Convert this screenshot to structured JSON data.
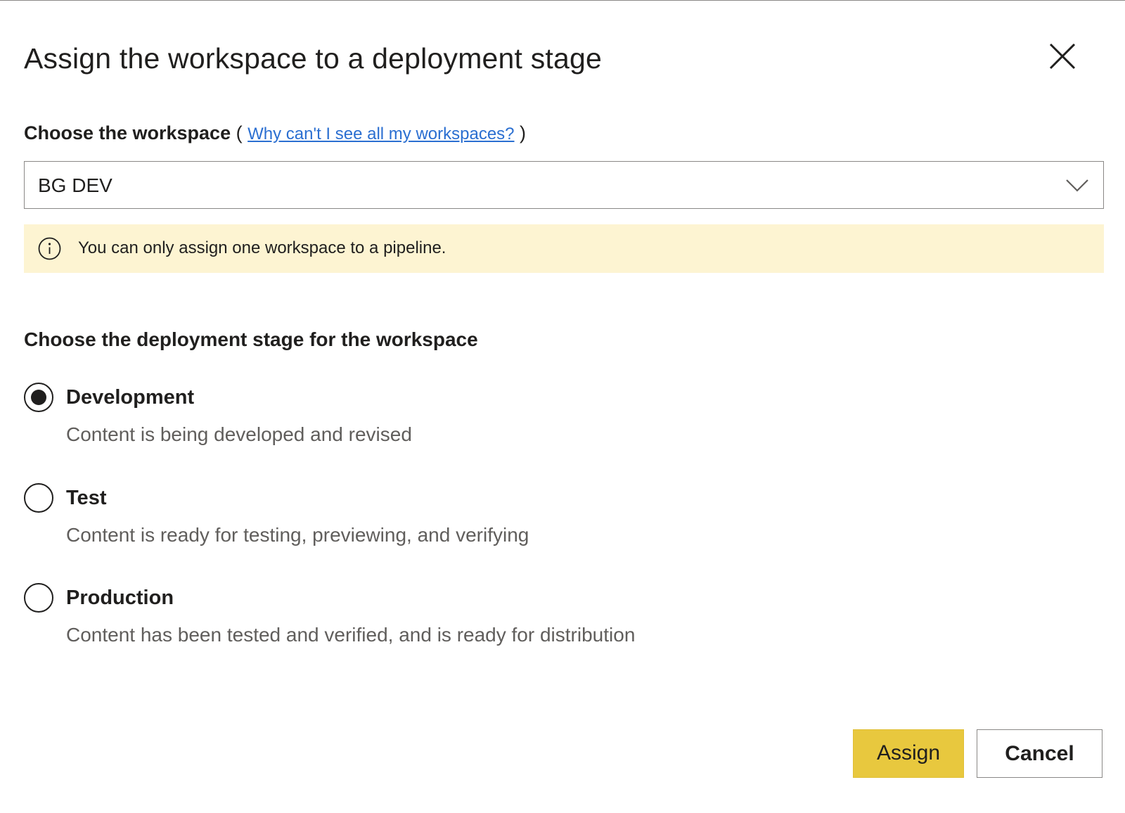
{
  "dialog": {
    "title": "Assign the workspace to a deployment stage",
    "close_icon": "close-icon"
  },
  "workspace": {
    "label": "Choose the workspace",
    "paren_open": "(",
    "help_link": "Why can't I see all my workspaces?",
    "paren_close": ")",
    "selected": "BG DEV",
    "dropdown_icon": "chevron-down-icon"
  },
  "notice": {
    "icon": "info-icon",
    "text": "You can only assign one workspace to a pipeline.",
    "background": "#fdf4d2"
  },
  "stage": {
    "heading": "Choose the deployment stage for the workspace",
    "options": [
      {
        "label": "Development",
        "description": "Content is being developed and revised",
        "selected": true
      },
      {
        "label": "Test",
        "description": "Content is ready for testing, previewing, and verifying",
        "selected": false
      },
      {
        "label": "Production",
        "description": "Content has been tested and verified, and is ready for distribution",
        "selected": false
      }
    ]
  },
  "actions": {
    "assign_label": "Assign",
    "cancel_label": "Cancel",
    "primary_color": "#e8c83e"
  }
}
